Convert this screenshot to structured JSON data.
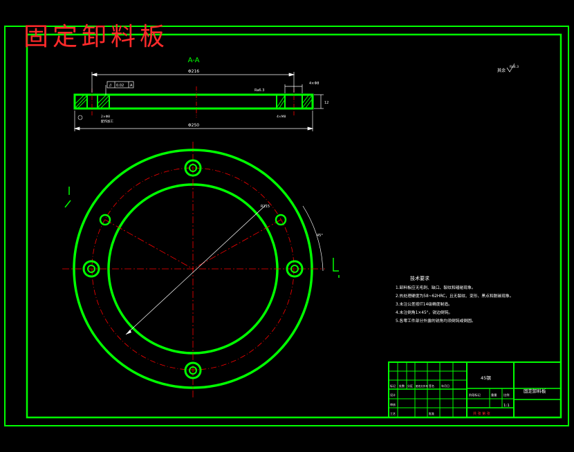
{
  "drawing": {
    "title_overlay": "固定卸料板",
    "section_label": "A-A",
    "roughness_other": "其余",
    "dims": {
      "top_width": "Φ216",
      "bottom_width": "Φ250",
      "hole_label": "4×Φ8",
      "thickness": "12",
      "flatness": "0.02",
      "datum": "A",
      "ra_top": "Ra6.3",
      "small_dim_1": "2×Φ8",
      "small_dim_2": "4×M8",
      "note_small": "配作加工",
      "radius_label": "R115",
      "angle_label": "45°",
      "roughness_value": "Ra6.3"
    },
    "section_markers": [
      "A",
      "A"
    ]
  },
  "notes": {
    "heading": "技术要求",
    "items": [
      "1.卸料板应无毛刺、缺口、裂纹和磕碰现象。",
      "2.热处理硬度为58~62HRC，且无裂纹、变形、黑点和脱碳现象。",
      "3.未注公差按IT14级精度制造。",
      "4.未注倒角1×45°，锐边倒钝。",
      "5.各零工件部分外露的锐角均须倒钝或倒圆。"
    ]
  },
  "title_block": {
    "material": "45钢",
    "part_name": "固定卸料板",
    "scale": "1:1",
    "sheet_info": "共 张 第 张",
    "labels": [
      "标记",
      "处数",
      "分区",
      "更改文件号",
      "签名",
      "年月日"
    ],
    "designer_row": "设计",
    "review_row": "审核",
    "process_row": "工艺",
    "approve_row": "批准",
    "stage_label": "阶段标记",
    "weight_label": "重量",
    "scale_label": "比例"
  },
  "colors": {
    "border": "#00ff00",
    "line": "#00ff00",
    "center": "#ff0000",
    "dim": "#ffffff",
    "title": "#ff2a2a"
  }
}
